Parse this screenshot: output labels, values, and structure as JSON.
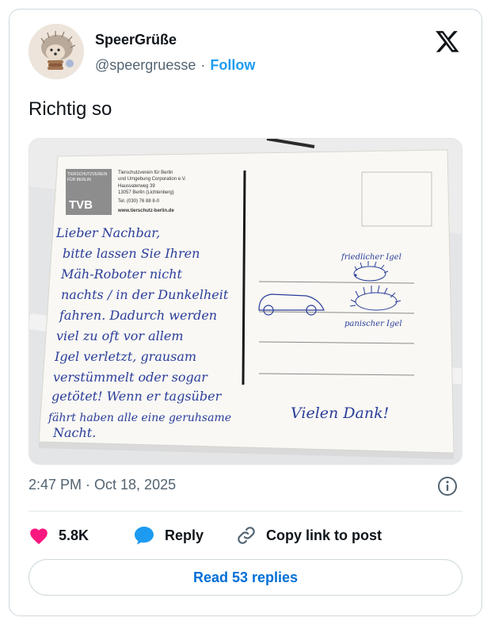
{
  "author": {
    "display_name": "SpeerGrüße",
    "handle": "@speergruesse",
    "separator": "·",
    "follow_label": "Follow"
  },
  "tweet": {
    "text": "Richtig so",
    "timestamp": "2:47 PM · Oct 18, 2025"
  },
  "postcard": {
    "org_badge_line1": "TIERSCHUTZVEREIN",
    "org_badge_line2": "FÜR BERLIN",
    "org_logo": "TVB",
    "address_lines": [
      "Tierschutzverein für Berlin",
      "und Umgebung Corporation e.V.",
      "Hausvaterweg 39",
      "13057 Berlin (Lichtenberg)",
      "Tel. (030) 76 88 8-0",
      "www.tierschutz-berlin.de"
    ],
    "message_lines": [
      "Lieber Nachbar,",
      "bitte lassen Sie Ihren",
      "Mäh-Roboter nicht",
      "nachts / in der Dunkelheit",
      "fahren. Dadurch werden",
      "viel zu oft vor allem",
      "Igel verletzt, grausam",
      "verstümmelt oder sogar",
      "getötet! Wenn er tagsüber",
      "fährt haben alle eine geruhsame",
      "Nacht."
    ],
    "sign_off": "Vielen Dank!",
    "label_happy_hedgehog": "friedlicher Igel",
    "label_panicked_hedgehog": "panischer Igel"
  },
  "actions": {
    "like_count": "5.8K",
    "reply_label": "Reply",
    "copy_link_label": "Copy link to post"
  },
  "read_replies_label": "Read 53 replies",
  "colors": {
    "like": "#f91880",
    "reply": "#1d9bf0",
    "follow": "#1d9bf0",
    "read_replies": "#006fd6",
    "ink": "#2a3d9a"
  },
  "icons": {
    "brand": "x-logo-icon",
    "info": "info-icon",
    "like": "heart-icon",
    "reply": "speech-bubble-icon",
    "copy": "link-icon"
  }
}
